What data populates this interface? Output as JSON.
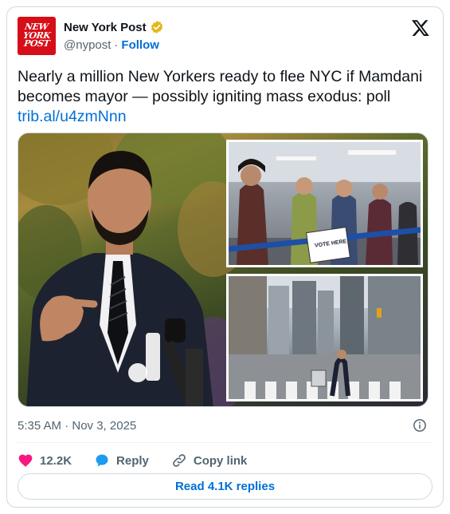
{
  "account": {
    "name": "New York Post",
    "handle": "@nypost",
    "separator": "·",
    "follow_label": "Follow",
    "avatar_lines": [
      "NEW",
      "YORK",
      "POST"
    ],
    "verified_icon": "verified-badge-icon",
    "brand_color": "#d60e17"
  },
  "platform_icon": "x-logo-icon",
  "tweet": {
    "text": "Nearly a million New Yorkers ready to flee NYC if Mamdani becomes mayor — possibly igniting mass exodus: poll",
    "link": "trib.al/u4zmNnn"
  },
  "media": {
    "inset_sign": "VOTE HERE"
  },
  "meta": {
    "timestamp": "5:35 AM · Nov 3, 2025"
  },
  "actions": {
    "likes": "12.2K",
    "reply_label": "Reply",
    "copy_label": "Copy link"
  },
  "read_replies_label": "Read 4.1K replies",
  "colors": {
    "link": "#006fd6",
    "muted": "#536471",
    "like": "#f91880",
    "reply": "#1d9bf0"
  }
}
